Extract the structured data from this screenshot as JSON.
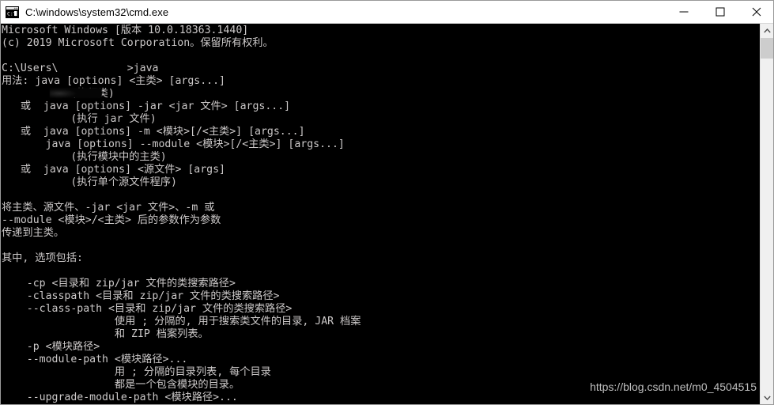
{
  "window": {
    "title": "C:\\windows\\system32\\cmd.exe",
    "app_icon": "cmd-console-icon",
    "controls": {
      "minimize": "minimize-button",
      "maximize": "maximize-button",
      "close": "close-button"
    }
  },
  "console": {
    "background_color": "#000000",
    "text_color": "#ccc9c9",
    "lines": [
      "Microsoft Windows [版本 10.0.18363.1440]",
      "(c) 2019 Microsoft Corporation。保留所有权利。",
      "",
      "C:\\Users\\           >java",
      "用法: java [options] <主类> [args...]",
      "           (执行类)",
      "   或  java [options] -jar <jar 文件> [args...]",
      "           (执行 jar 文件)",
      "   或  java [options] -m <模块>[/<主类>] [args...]",
      "       java [options] --module <模块>[/<主类>] [args...]",
      "           (执行模块中的主类)",
      "   或  java [options] <源文件> [args]",
      "           (执行单个源文件程序)",
      "",
      "将主类、源文件、-jar <jar 文件>、-m 或",
      "--module <模块>/<主类> 后的参数作为参数",
      "传递到主类。",
      "",
      "其中, 选项包括:",
      "",
      "    -cp <目录和 zip/jar 文件的类搜索路径>",
      "    -classpath <目录和 zip/jar 文件的类搜索路径>",
      "    --class-path <目录和 zip/jar 文件的类搜索路径>",
      "                  使用 ; 分隔的, 用于搜索类文件的目录, JAR 档案",
      "                  和 ZIP 档案列表。",
      "    -p <模块路径>",
      "    --module-path <模块路径>...",
      "                  用 ; 分隔的目录列表, 每个目录",
      "                  都是一个包含模块的目录。",
      "    --upgrade-module-path <模块路径>..."
    ],
    "redacted_username": true,
    "prompt_command": "java"
  },
  "watermark": {
    "text": "https://blog.csdn.net/m0_4504515"
  },
  "scrollbar": {
    "up_arrow": "chevron-up-icon",
    "down_arrow": "chevron-down-icon",
    "thumb": "scrollbar-thumb"
  }
}
